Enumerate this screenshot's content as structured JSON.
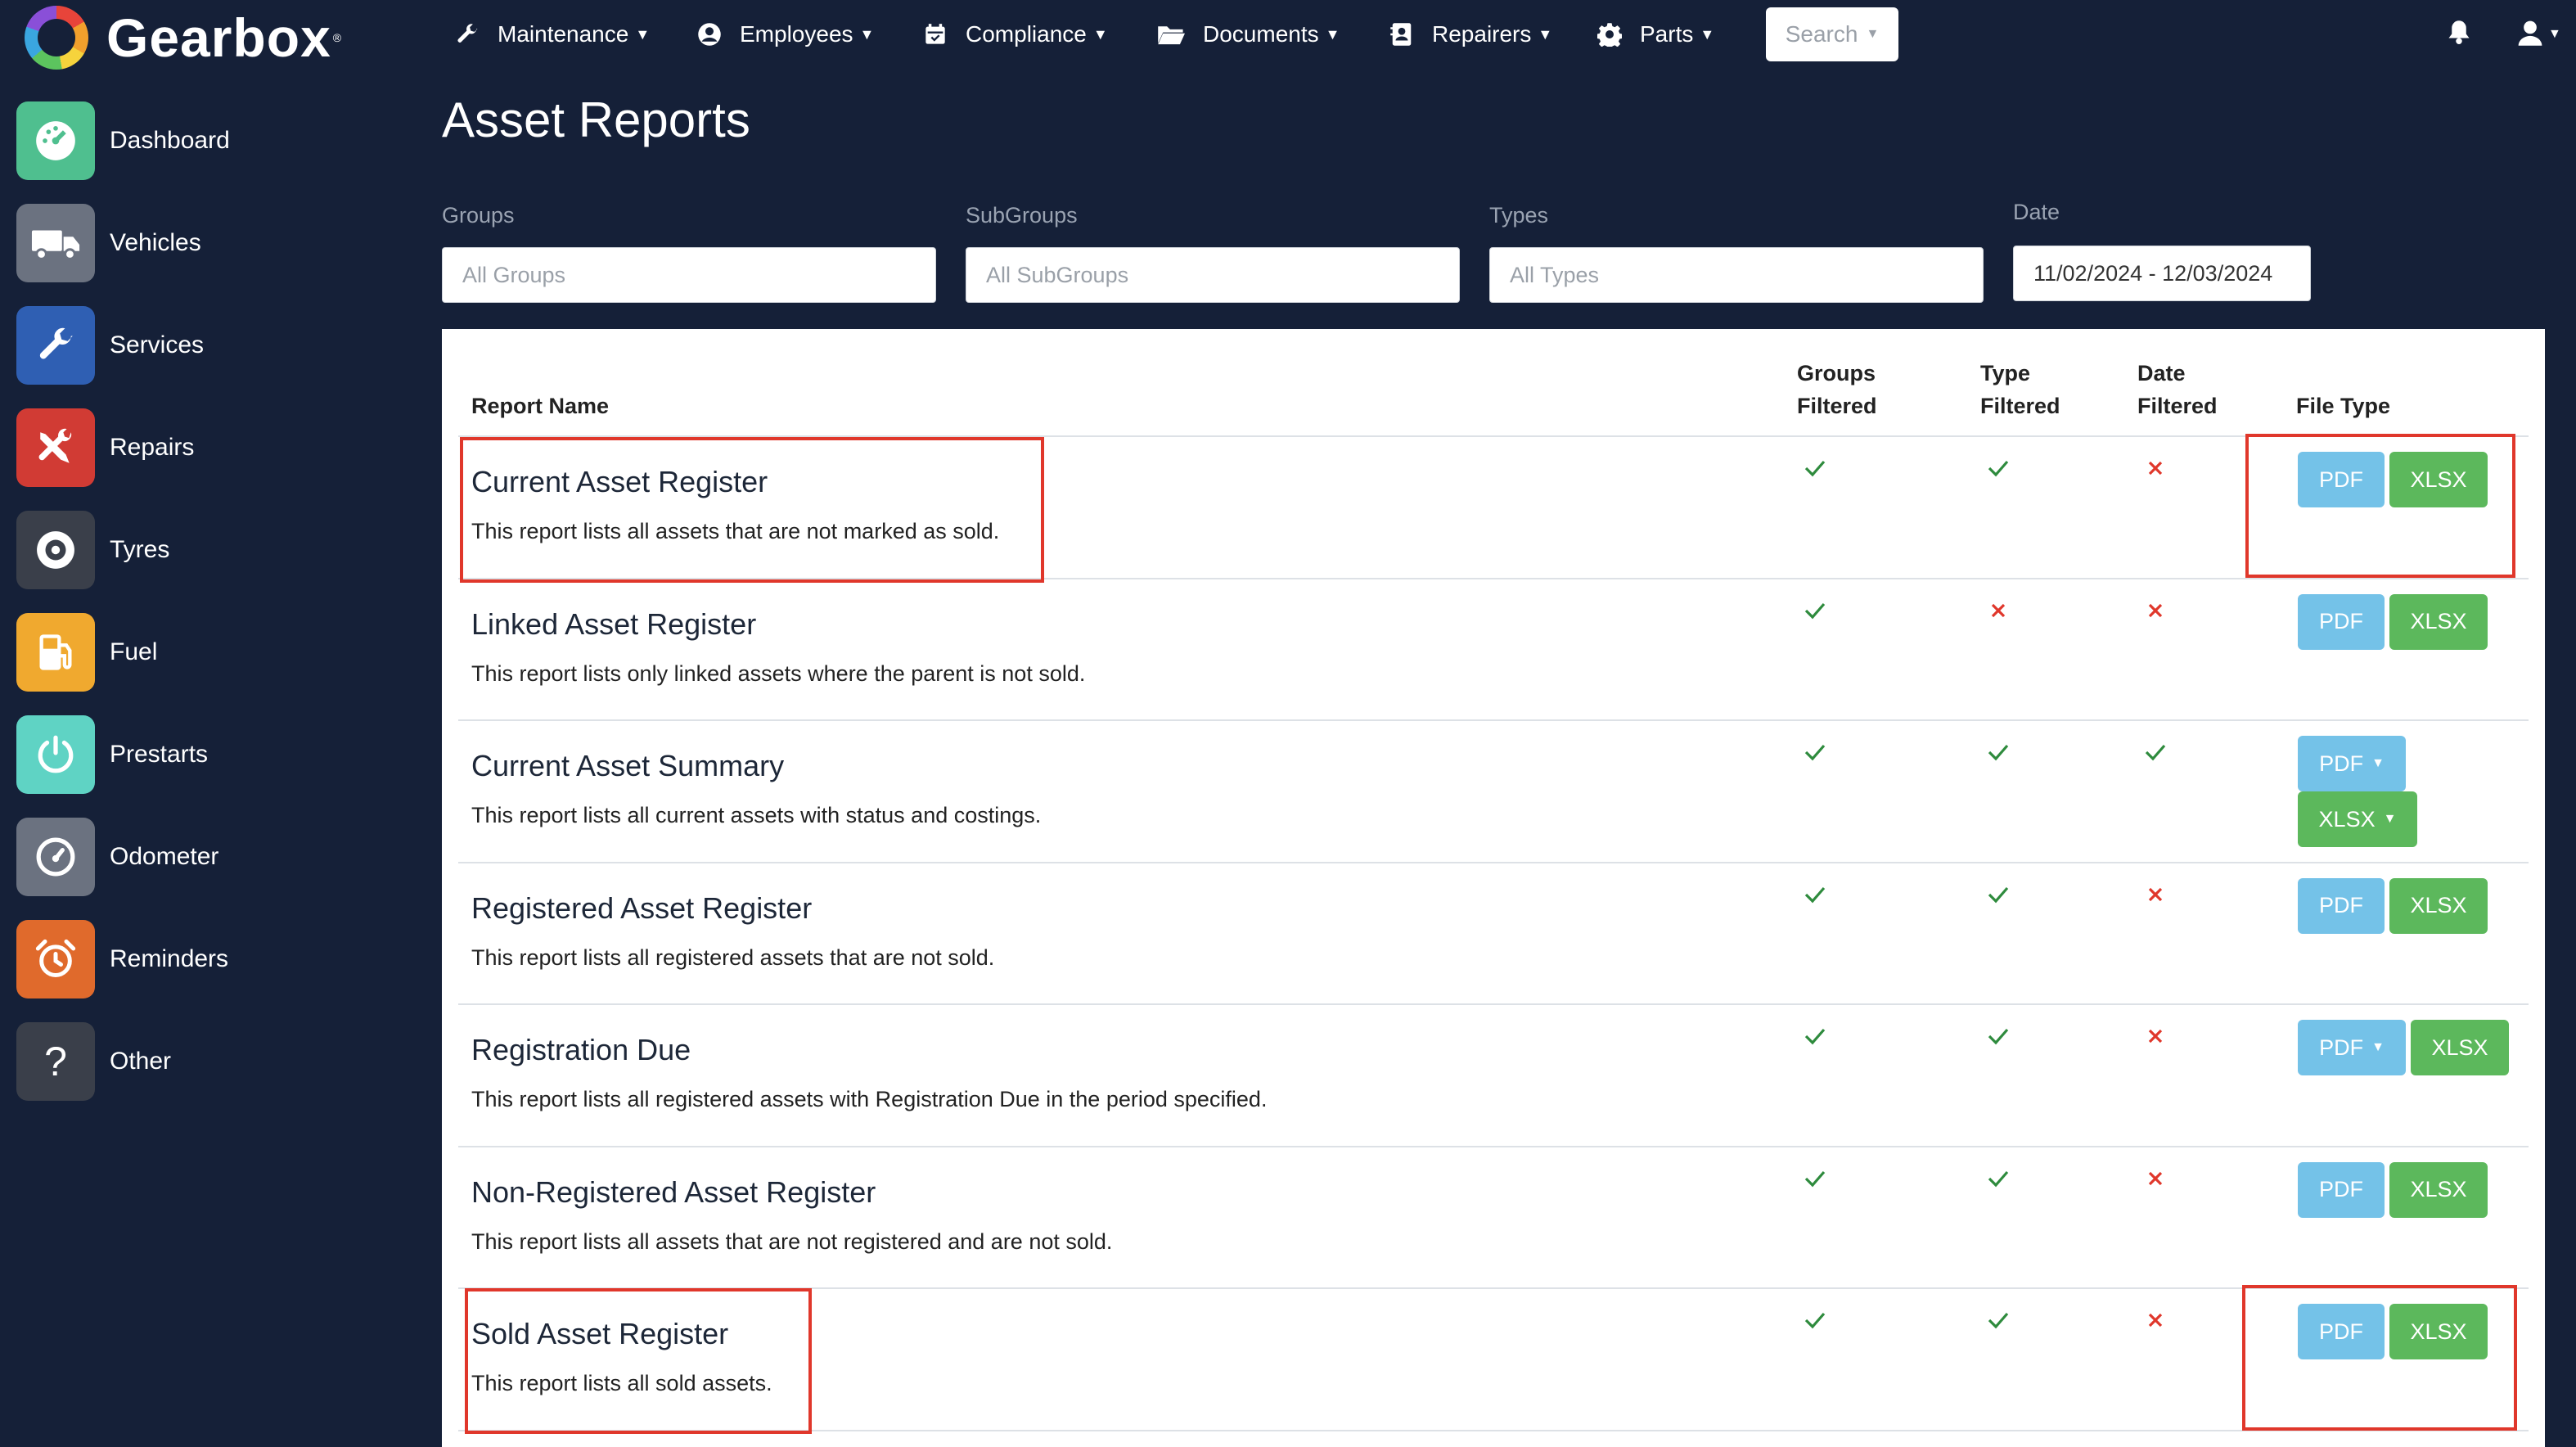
{
  "brand": {
    "name": "Gearbox"
  },
  "nav": [
    {
      "label": "Maintenance",
      "icon": "wrench-icon"
    },
    {
      "label": "Employees",
      "icon": "user-circle-icon"
    },
    {
      "label": "Compliance",
      "icon": "calendar-icon"
    },
    {
      "label": "Documents",
      "icon": "folder-icon"
    },
    {
      "label": "Repairers",
      "icon": "contact-card-icon"
    },
    {
      "label": "Parts",
      "icon": "gear-icon"
    }
  ],
  "search": {
    "label": "Search"
  },
  "sidebar": {
    "items": [
      {
        "label": "Dashboard",
        "icon": "speedometer-icon",
        "color": "#4fbf8f"
      },
      {
        "label": "Vehicles",
        "icon": "truck-icon",
        "color": "#6b7280"
      },
      {
        "label": "Services",
        "icon": "wrench-icon",
        "color": "#2f5fb3"
      },
      {
        "label": "Repairs",
        "icon": "tools-icon",
        "color": "#d13b34"
      },
      {
        "label": "Tyres",
        "icon": "tyre-icon",
        "color": "#3a3f4a"
      },
      {
        "label": "Fuel",
        "icon": "fuel-pump-icon",
        "color": "#f0a92f"
      },
      {
        "label": "Prestarts",
        "icon": "power-icon",
        "color": "#5fd3c4"
      },
      {
        "label": "Odometer",
        "icon": "odometer-icon",
        "color": "#6b7280"
      },
      {
        "label": "Reminders",
        "icon": "alarm-clock-icon",
        "color": "#e06a2c"
      },
      {
        "label": "Other",
        "icon": "question-icon",
        "color": "#3a3f4a"
      }
    ]
  },
  "page": {
    "title": "Asset Reports"
  },
  "filters": {
    "groups": {
      "label": "Groups",
      "placeholder": "All Groups"
    },
    "subgroups": {
      "label": "SubGroups",
      "placeholder": "All SubGroups"
    },
    "types": {
      "label": "Types",
      "placeholder": "All Types"
    },
    "date": {
      "label": "Date",
      "value": "11/02/2024 - 12/03/2024"
    }
  },
  "table": {
    "headers": {
      "report_name": "Report Name",
      "groups_filtered_1": "Groups",
      "groups_filtered_2": "Filtered",
      "type_filtered_1": "Type",
      "type_filtered_2": "Filtered",
      "date_filtered_1": "Date",
      "date_filtered_2": "Filtered",
      "file_type": "File Type"
    },
    "rows": [
      {
        "title": "Current Asset Register",
        "desc": "This report lists all assets that are not marked as sold.",
        "groups": true,
        "type": true,
        "date": false,
        "pdf": "PDF",
        "xlsx": "XLSX"
      },
      {
        "title": "Linked Asset Register",
        "desc": "This report lists only linked assets where the parent is not sold.",
        "groups": true,
        "type": false,
        "date": false,
        "pdf": "PDF",
        "xlsx": "XLSX"
      },
      {
        "title": "Current Asset Summary",
        "desc": "This report lists all current assets with status and costings.",
        "groups": true,
        "type": true,
        "date": true,
        "pdf": "PDF",
        "xlsx": "XLSX"
      },
      {
        "title": "Registered Asset Register",
        "desc": "This report lists all registered assets that are not sold.",
        "groups": true,
        "type": true,
        "date": false,
        "pdf": "PDF",
        "xlsx": "XLSX"
      },
      {
        "title": "Registration Due",
        "desc": "This report lists all registered assets with Registration Due in the period specified.",
        "groups": true,
        "type": true,
        "date": false,
        "pdf": "PDF",
        "xlsx": "XLSX"
      },
      {
        "title": "Non-Registered Asset Register",
        "desc": "This report lists all assets that are not registered and are not sold.",
        "groups": true,
        "type": true,
        "date": false,
        "pdf": "PDF",
        "xlsx": "XLSX"
      },
      {
        "title": "Sold Asset Register",
        "desc": "This report lists all sold assets.",
        "groups": true,
        "type": true,
        "date": false,
        "pdf": "PDF",
        "xlsx": "XLSX"
      }
    ]
  },
  "colors": {
    "check": "#2e8b3d",
    "cross": "#e0372b",
    "highlight": "#e0372b",
    "pdf": "#74c2e8",
    "xlsx": "#5cb85c"
  }
}
